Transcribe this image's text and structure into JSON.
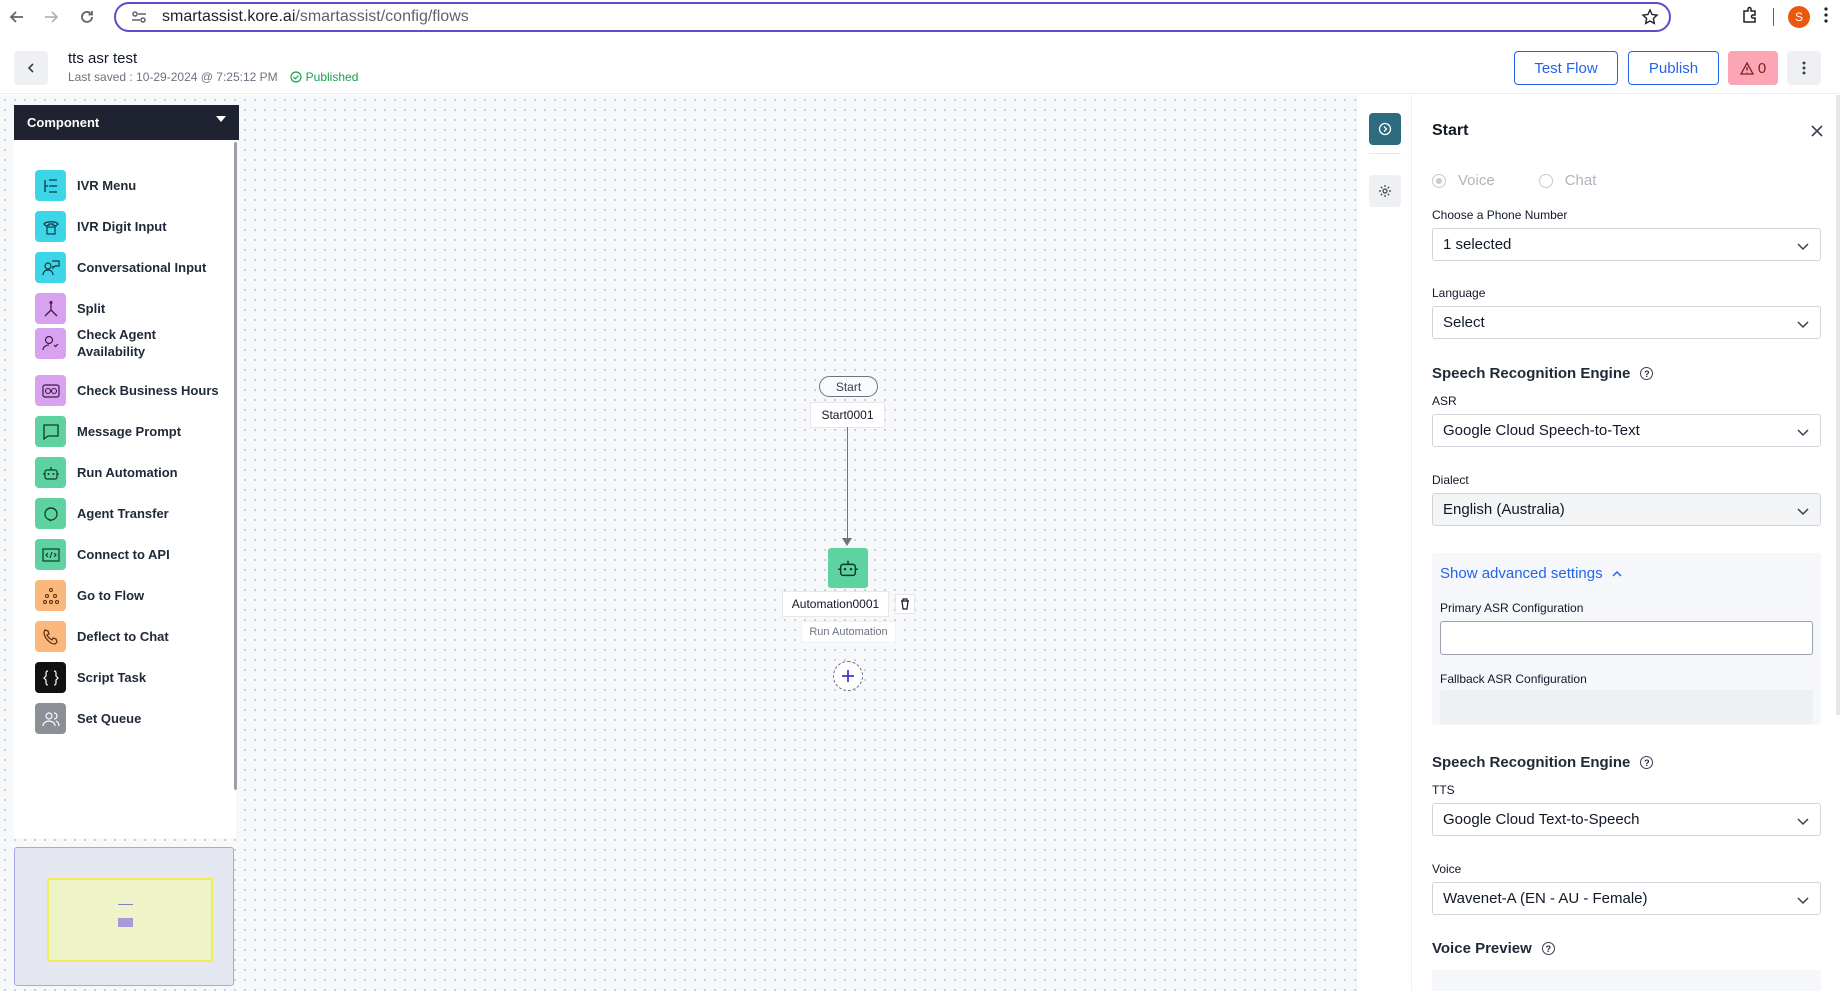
{
  "browser": {
    "url_host": "smartassist.kore.ai",
    "url_path": "/smartassist/config/flows",
    "profile_initial": "S"
  },
  "header": {
    "title": "tts asr test",
    "last_saved": "Last saved : 10-29-2024 @ 7:25:12 PM",
    "status": "Published",
    "test_flow_label": "Test Flow",
    "publish_label": "Publish",
    "warning_count": "0"
  },
  "palette": {
    "title": "Component",
    "items": [
      {
        "label": "IVR Menu",
        "icon": "ivr-menu-icon",
        "color": "#3dd5e8"
      },
      {
        "label": "IVR Digit Input",
        "icon": "keypad-phone-icon",
        "color": "#3dd5e8"
      },
      {
        "label": "Conversational Input",
        "icon": "conversation-icon",
        "color": "#3dd5e8"
      },
      {
        "label": "Split",
        "icon": "split-icon",
        "color": "#d8a2f0"
      },
      {
        "label": "Check Agent Availability",
        "icon": "agent-check-icon",
        "color": "#d8a2f0"
      },
      {
        "label": "Check Business Hours",
        "icon": "business-hours-icon",
        "color": "#d8a2f0"
      },
      {
        "label": "Message Prompt",
        "icon": "message-icon",
        "color": "#5ed3a1"
      },
      {
        "label": "Run Automation",
        "icon": "robot-icon",
        "color": "#5ed3a1"
      },
      {
        "label": "Agent Transfer",
        "icon": "agent-transfer-icon",
        "color": "#5ed3a1"
      },
      {
        "label": "Connect to API",
        "icon": "code-icon",
        "color": "#5ed3a1"
      },
      {
        "label": "Go to Flow",
        "icon": "flow-icon",
        "color": "#fbb87d"
      },
      {
        "label": "Deflect to Chat",
        "icon": "phone-chat-icon",
        "color": "#fbb87d"
      },
      {
        "label": "Script Task",
        "icon": "braces-icon",
        "color": "#111111"
      },
      {
        "label": "Set Queue",
        "icon": "users-icon",
        "color": "#8b8f96"
      }
    ]
  },
  "canvas": {
    "start_pill": "Start",
    "start_node": "Start0001",
    "automation_node": "Automation0001",
    "automation_type": "Run Automation"
  },
  "panel": {
    "title": "Start",
    "channel_voice": "Voice",
    "channel_chat": "Chat",
    "phone_label": "Choose a Phone Number",
    "phone_value": "1 selected",
    "language_label": "Language",
    "language_value": "Select",
    "sre_title": "Speech Recognition Engine",
    "asr_label": "ASR",
    "asr_value": "Google Cloud Speech-to-Text",
    "dialect_label": "Dialect",
    "dialect_value": "English (Australia)",
    "advanced_link": "Show advanced settings",
    "primary_asr_label": "Primary ASR Configuration",
    "primary_asr_value": "",
    "fallback_asr_label": "Fallback ASR Configuration",
    "tts_section_title": "Speech Recognition Engine",
    "tts_label": "TTS",
    "tts_value": "Google Cloud Text-to-Speech",
    "voice_label": "Voice",
    "voice_value": "Wavenet-A (EN - AU - Female)",
    "voice_preview_title": "Voice Preview"
  }
}
